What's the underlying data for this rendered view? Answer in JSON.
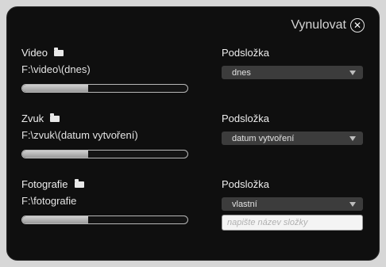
{
  "reset": {
    "label": "Vynulovat",
    "icon": "close-circle-icon"
  },
  "sections": [
    {
      "label": "Video",
      "path": "F:\\video\\(dnes)",
      "usage_fraction": 0.4,
      "subfolder_label": "Podsložka",
      "subfolder_value": "dnes"
    },
    {
      "label": "Zvuk",
      "path": "F:\\zvuk\\(datum vytvoření)",
      "usage_fraction": 0.4,
      "subfolder_label": "Podsložka",
      "subfolder_value": "datum vytvoření"
    },
    {
      "label": "Fotografie",
      "path": "F:\\fotografie",
      "usage_fraction": 0.4,
      "subfolder_label": "Podsložka",
      "subfolder_value": "vlastní",
      "custom_name_placeholder": "napište název složky",
      "custom_name_value": ""
    }
  ]
}
